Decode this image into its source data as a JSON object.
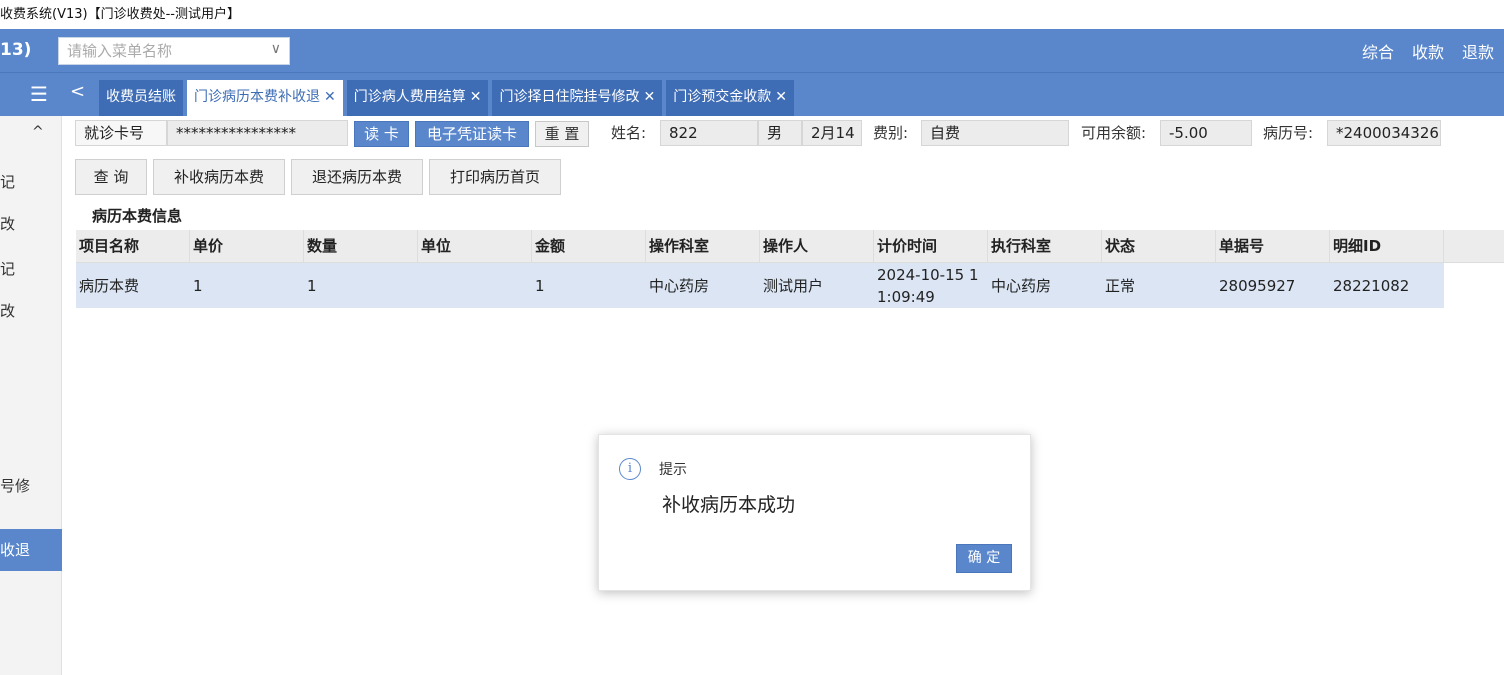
{
  "window": {
    "title": "收费系统(V13)【门诊收费处--测试用户】"
  },
  "topbar": {
    "app_version": "13)",
    "search_placeholder": "请输入菜单名称",
    "actions": [
      "综合",
      "收款",
      "退款"
    ]
  },
  "tabs": [
    {
      "label": "收费员结账",
      "closable": false,
      "active": false
    },
    {
      "label": "门诊病历本费补收退",
      "closable": true,
      "active": true
    },
    {
      "label": "门诊病人费用结算",
      "closable": true,
      "active": false
    },
    {
      "label": "门诊择日住院挂号修改",
      "closable": true,
      "active": false
    },
    {
      "label": "门诊预交金收款",
      "closable": true,
      "active": false
    }
  ],
  "sidebar": {
    "items": [
      "记",
      "改",
      "记",
      "改",
      "号修",
      "收退"
    ],
    "active_item": "收退"
  },
  "patient": {
    "card_label": "就诊卡号",
    "card_value": "****************",
    "read_card_label": "读 卡",
    "e_card_label": "电子凭证读卡",
    "reset_label": "重 置",
    "name_label": "姓名:",
    "name_value": "822",
    "gender": "男",
    "age": "2月14",
    "fee_type_label": "费别:",
    "fee_type_value": "自费",
    "balance_label": "可用余额:",
    "balance_value": "-5.00",
    "record_no_label": "病历号:",
    "record_no_value": "*2400034326"
  },
  "actions": {
    "query": "查 询",
    "charge": "补收病历本费",
    "refund": "退还病历本费",
    "print": "打印病历首页"
  },
  "section_title": "病历本费信息",
  "table": {
    "columns": [
      "项目名称",
      "单价",
      "数量",
      "单位",
      "金额",
      "操作科室",
      "操作人",
      "计价时间",
      "执行科室",
      "状态",
      "单据号",
      "明细ID"
    ],
    "rows": [
      [
        "病历本费",
        "1",
        "1",
        "",
        "1",
        "中心药房",
        "测试用户",
        "2024-10-15 11:09:49",
        "中心药房",
        "正常",
        "28095927",
        "28221082"
      ]
    ]
  },
  "dialog": {
    "title": "提示",
    "message": "补收病历本成功",
    "ok_label": "确 定",
    "icon": "info-icon"
  },
  "colors": {
    "primary": "#5a87cc",
    "row_selected": "#dbe5f4"
  }
}
